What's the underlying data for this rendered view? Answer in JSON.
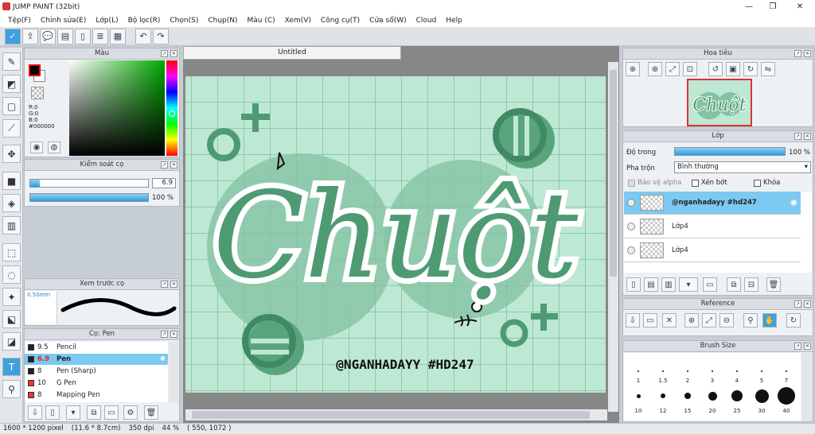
{
  "window": {
    "title": "JUMP PAINT (32bit)"
  },
  "menu": [
    "Tệp(F)",
    "Chỉnh sửa(E)",
    "Lớp(L)",
    "Bộ lọc(R)",
    "Chọn(S)",
    "Chụp(N)",
    "Màu (C)",
    "Xem(V)",
    "Công cụ(T)",
    "Cửa sổ(W)",
    "Cloud",
    "Help"
  ],
  "color_panel": {
    "title": "Màu",
    "r": "R:0",
    "g": "G:0",
    "b": "B:0",
    "hex": "#000000",
    "fg": "#000000",
    "bg": "#ffffff"
  },
  "brush_control": {
    "title": "Kiểm soát cọ",
    "size": "6.9",
    "opacity": "100 %",
    "size_fraction": 0.08,
    "opacity_fraction": 1.0
  },
  "preview": {
    "title": "Xem trước cọ",
    "size_label": "0.50mm"
  },
  "brush_list": {
    "title": "Cọ: Pen",
    "items": [
      {
        "size": "9.5",
        "name": "Pencil",
        "color": "#222222",
        "selected": false
      },
      {
        "size": "6.9",
        "name": "Pen",
        "color": "#222222",
        "selected": true
      },
      {
        "size": "8",
        "name": "Pen (Sharp)",
        "color": "#222222",
        "selected": false
      },
      {
        "size": "10",
        "name": "G Pen",
        "color": "#e53935",
        "selected": false
      },
      {
        "size": "8",
        "name": "Mapping Pen",
        "color": "#e53935",
        "selected": false
      }
    ]
  },
  "document": {
    "tab": "Untitled"
  },
  "artwork": {
    "title_text": "Chuột",
    "handle": "@NGANHADAYY #HD247",
    "bg": "#bde8d4",
    "accent": "#4e9a73"
  },
  "navigator": {
    "title": "Hoa tiêu"
  },
  "layers": {
    "title": "Lớp",
    "opacity_label": "Độ trong",
    "opacity": "100 %",
    "opacity_fraction": 1.0,
    "blend_label": "Pha trộn",
    "blend_value": "Bình thường",
    "protect_alpha": "Bảo vệ alpha",
    "clip": "Xén bớt",
    "lock": "Khóa",
    "rows": [
      {
        "name": "@nganhadayy #hd247",
        "selected": true
      },
      {
        "name": "Lớp4",
        "selected": false
      },
      {
        "name": "Lớp4",
        "selected": false
      }
    ]
  },
  "reference": {
    "title": "Reference"
  },
  "brush_size": {
    "title": "Brush Size",
    "row1": [
      "1",
      "1.5",
      "2",
      "3",
      "4",
      "5",
      "7"
    ],
    "row2": [
      "10",
      "12",
      "15",
      "20",
      "25",
      "30",
      "40"
    ]
  },
  "status": {
    "dims": "1600 * 1200 pixel",
    "phys": "(11.6 * 8.7cm)",
    "dpi": "350 dpi",
    "zoom": "44 %",
    "coord": "( 550, 1072 )"
  }
}
